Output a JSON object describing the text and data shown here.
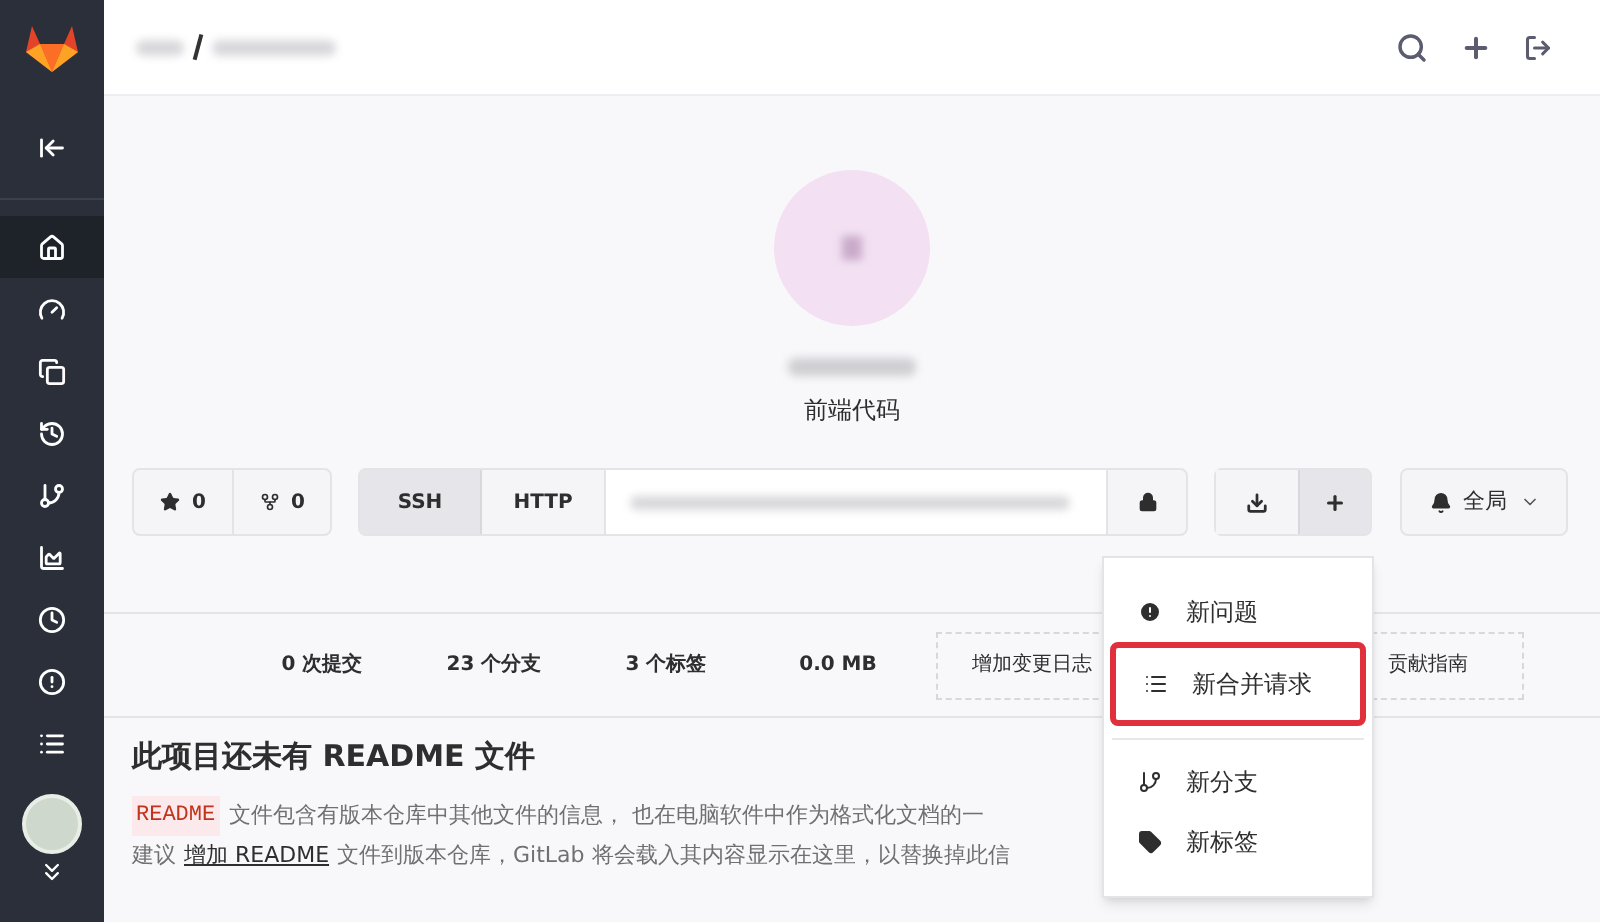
{
  "sidebar": {
    "items": [
      {
        "selected": false
      },
      {
        "selected": true
      },
      {
        "selected": false
      },
      {
        "selected": false
      },
      {
        "selected": false
      },
      {
        "selected": false
      },
      {
        "selected": false
      },
      {
        "selected": false
      },
      {
        "selected": false
      },
      {
        "selected": false
      }
    ]
  },
  "project": {
    "description": "前端代码"
  },
  "counters": [
    {
      "kind": "star",
      "value": "0"
    },
    {
      "kind": "fork",
      "value": "0"
    }
  ],
  "clone": {
    "tabs": [
      {
        "label": "SSH",
        "selected": true
      },
      {
        "label": "HTTP",
        "selected": false
      }
    ]
  },
  "notification": {
    "label": "全局"
  },
  "stats": [
    "0 次提交",
    "23 个分支",
    "3 个标签",
    "0.0 MB"
  ],
  "actions": [
    "增加变更日志",
    "贡献指南"
  ],
  "readme": {
    "title": "此项目还未有 README 文件",
    "code": "README",
    "line1": "文件包含有版本仓库中其他文件的信息， 也在电脑软件中作为格式化文档的一",
    "prefix": "建议",
    "link": "增加 README",
    "line2": "文件到版本仓库，GitLab 将会载入其内容显示在这里，以替换掉此信"
  },
  "dropdown": {
    "items": [
      {
        "label": "新问题",
        "kind": "issue",
        "highlighted": false
      },
      {
        "label": "新合并请求",
        "kind": "merge",
        "highlighted": true
      },
      {
        "label": "新分支",
        "kind": "branch",
        "highlighted": false
      },
      {
        "label": "新标签",
        "kind": "tag",
        "highlighted": false
      }
    ]
  }
}
